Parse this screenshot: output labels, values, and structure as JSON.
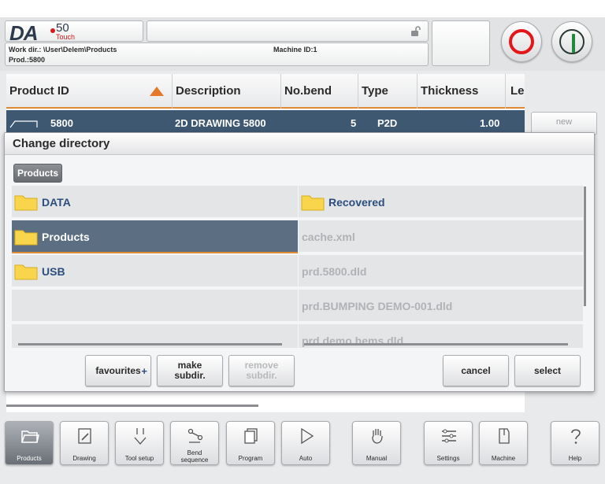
{
  "header": {
    "logo_da": "DA",
    "logo_50": "50",
    "logo_touch": "Touch",
    "work_dir": "Work dir.: \\User\\Delem\\Products",
    "prod": "Prod.:5800",
    "machine_id": "Machine ID:1"
  },
  "table": {
    "columns": [
      "Product ID",
      "Description",
      "No.bend",
      "Type",
      "Thickness",
      "Le"
    ],
    "row": {
      "id": "5800",
      "description": "2D DRAWING 5800",
      "nobend": "5",
      "type": "P2D",
      "thickness": "1.00"
    },
    "new_button": "new"
  },
  "dialog": {
    "title": "Change directory",
    "breadcrumb": "Products",
    "left_items": [
      {
        "label": "DATA",
        "selected": false
      },
      {
        "label": "Products",
        "selected": true
      },
      {
        "label": "USB",
        "selected": false
      }
    ],
    "right_items": [
      {
        "label": "Recovered",
        "kind": "folder"
      },
      {
        "label": "cache.xml",
        "kind": "file"
      },
      {
        "label": "prd.5800.dld",
        "kind": "file"
      },
      {
        "label": "prd.BUMPING DEMO-001.dld",
        "kind": "file"
      },
      {
        "label": "prd.demo hems.dld",
        "kind": "file"
      }
    ],
    "buttons": {
      "favourites": "favourites",
      "favourites_plus": "+",
      "make_l1": "make",
      "make_l2": "subdir.",
      "remove_l1": "remove",
      "remove_l2": "subdir.",
      "cancel": "cancel",
      "select": "select"
    }
  },
  "toolbar": {
    "products": "Products",
    "drawing": "Drawing",
    "tool_setup": "Tool setup",
    "bend_l1": "Bend",
    "bend_l2": "sequence",
    "program": "Program",
    "auto": "Auto",
    "manual": "Manual",
    "settings": "Settings",
    "machine": "Machine",
    "help": "Help"
  },
  "colors": {
    "accent_orange": "#e08a36",
    "selection_blue": "#5b6e82",
    "stop_red": "#e3161a",
    "start_green": "#1f8a3c"
  }
}
